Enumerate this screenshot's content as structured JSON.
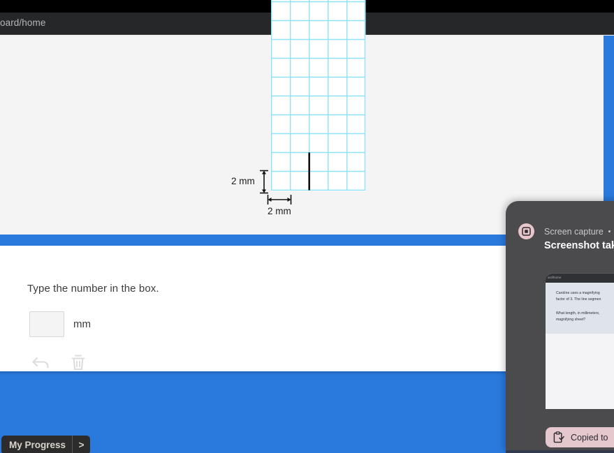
{
  "browser": {
    "url_fragment": "oard/home"
  },
  "figure": {
    "vertical_dimension_label": "2 mm",
    "horizontal_dimension_label": "2 mm",
    "grid": {
      "columns": 5,
      "visible_rows": 9,
      "cell_size_px": 27,
      "grid_color": "#8fe2fa",
      "segment_color": "#111111",
      "segment_column_index": 2,
      "segment_rows_spanned": 2
    }
  },
  "answer": {
    "prompt": "Type the number in the box.",
    "input_value": "",
    "input_placeholder": "",
    "unit": "mm",
    "undo_icon": "undo-arrow-icon",
    "delete_icon": "trash-can-icon"
  },
  "progress": {
    "label": "My Progress",
    "chevron": ">"
  },
  "notification": {
    "app_name": "Screen capture",
    "title": "Screenshot tak",
    "icon": "screen-capture-icon",
    "thumbnail": {
      "url_fragment": "ard/home",
      "lines": [
        "Caroline uses a magnifying",
        "factor of 3. The line segmen",
        "What length, in millimeters,",
        "magnifying sheet?"
      ]
    },
    "toast": {
      "icon": "clipboard-check-icon",
      "text": "Copied to"
    }
  },
  "colors": {
    "accent_blue": "#2a7ade",
    "grid_blue": "#8fe2fa",
    "notif_bg": "#4b4a4c",
    "toast_pink": "#e5c7ce",
    "chrome_dark": "#262729"
  }
}
